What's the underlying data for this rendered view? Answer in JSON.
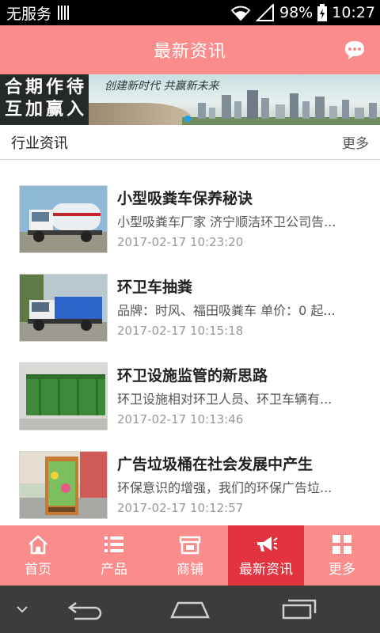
{
  "status_bar": {
    "carrier": "无服务",
    "battery": "98%",
    "time": "10:27"
  },
  "header": {
    "title": "最新资讯",
    "chat_icon": "chat-bubble-icon"
  },
  "banner": {
    "left_text": [
      "合",
      "期",
      "作",
      "待",
      "互",
      "加",
      "赢",
      "入"
    ],
    "slogan": "创建新时代  共赢新未来"
  },
  "section": {
    "title": "行业资讯",
    "more_label": "更多"
  },
  "news": [
    {
      "title": "小型吸粪车保养秘诀",
      "summary": "小型吸粪车厂家 济宁顺洁环卫公司告...",
      "date": "2017-02-17 10:23:20",
      "thumb": "truck-photo"
    },
    {
      "title": "环卫车抽粪",
      "summary": "品牌：时风、福田吸粪车 单价：0 起...",
      "date": "2017-02-17 10:15:18",
      "thumb": "truck-photo"
    },
    {
      "title": "环卫设施监管的新思路",
      "summary": "环卫设施相对环卫人员、环卫车辆有...",
      "date": "2017-02-17 10:13:46",
      "thumb": "container-photo"
    },
    {
      "title": "广告垃圾桶在社会发展中产生",
      "summary": "环保意识的增强，我们的环保广告垃...",
      "date": "2017-02-17 10:12:57",
      "thumb": "trash-bin-photo"
    }
  ],
  "tabbar": {
    "tabs": [
      {
        "label": "首页",
        "icon": "home-icon"
      },
      {
        "label": "产品",
        "icon": "list-icon"
      },
      {
        "label": "商铺",
        "icon": "shop-icon"
      },
      {
        "label": "最新资讯",
        "icon": "megaphone-icon"
      },
      {
        "label": "更多",
        "icon": "grid-icon"
      }
    ],
    "active_index": 3
  },
  "colors": {
    "accent": "#fb8c8c",
    "active_tab": "#e3333f"
  }
}
